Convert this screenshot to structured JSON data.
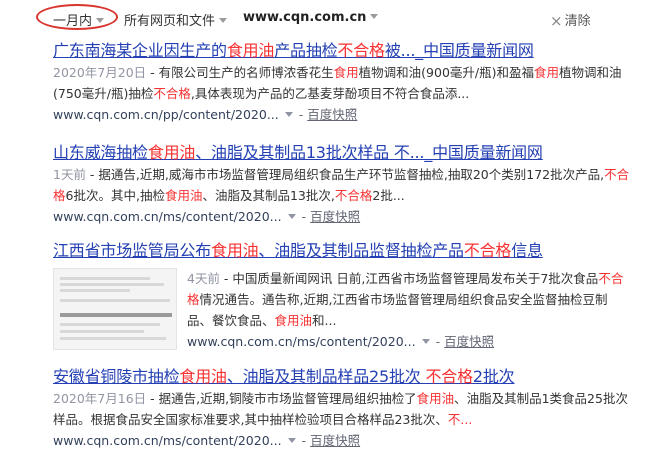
{
  "filters": {
    "time": "一月内",
    "type": "所有网页和文件",
    "site": "www.cqn.com.cn",
    "clear_icon": "close-icon",
    "clear": "清除"
  },
  "colors": {
    "link": "#2440b3",
    "highlight": "#f73131",
    "circle": "#d9352e",
    "date": "#9195a3"
  },
  "results": [
    {
      "title": [
        {
          "t": "广东南海某企业因生产的"
        },
        {
          "t": "食用油",
          "h": true
        },
        {
          "t": "产品抽检"
        },
        {
          "t": "不合格",
          "h": true
        },
        {
          "t": "被..._中国质量新闻网"
        }
      ],
      "snippet": [
        {
          "t": "2020年7月20日",
          "date": true
        },
        {
          "t": " - 有限公司生产的名师博浓香花生"
        },
        {
          "t": "食用",
          "h": true
        },
        {
          "t": "植物调和油(900毫升/瓶)和盈福"
        },
        {
          "t": "食用",
          "h": true
        },
        {
          "t": "植物调和油(750毫升/瓶)抽检"
        },
        {
          "t": "不合格",
          "h": true
        },
        {
          "t": ",具体表现为产品的乙基麦芽酚项目不符合食品添..."
        }
      ],
      "url": "www.cqn.com.cn/pp/content/2020...",
      "snapshot": "百度快照"
    },
    {
      "title": [
        {
          "t": "山东威海抽检"
        },
        {
          "t": "食用油",
          "h": true
        },
        {
          "t": "、油脂及其制品13批次样品 不..._中国质量新闻网"
        }
      ],
      "snippet": [
        {
          "t": "1天前",
          "date": true
        },
        {
          "t": " - 据通告,近期,威海市市场监督管理局组织食品生产环节监督抽检,抽取20个类别172批次产品,"
        },
        {
          "t": "不合格",
          "h": true
        },
        {
          "t": "6批次。其中,抽检"
        },
        {
          "t": "食用油",
          "h": true
        },
        {
          "t": "、油脂及其制品13批次,"
        },
        {
          "t": "不合格",
          "h": true
        },
        {
          "t": "2批..."
        }
      ],
      "url": "www.cqn.com.cn/ms/content/2020...",
      "snapshot": "百度快照"
    },
    {
      "title": [
        {
          "t": "江西省市场监管局公布"
        },
        {
          "t": "食用油",
          "h": true
        },
        {
          "t": "、油脂及其制品监督抽检产品"
        },
        {
          "t": "不合格",
          "h": true
        },
        {
          "t": "信息"
        }
      ],
      "snippet": [
        {
          "t": "4天前",
          "date": true
        },
        {
          "t": " - 中国质量新闻网讯 日前,江西省市场监督管理局发布关于7批次食品"
        },
        {
          "t": "不合格",
          "h": true
        },
        {
          "t": "情况通告。通告称,近期,江西省市场监督管理局组织食品安全监督抽检豆制品、餐饮食品、"
        },
        {
          "t": "食用油",
          "h": true
        },
        {
          "t": "和..."
        }
      ],
      "url": "www.cqn.com.cn/ms/content/2020...",
      "snapshot": "百度快照"
    },
    {
      "title": [
        {
          "t": "安徽省铜陵市抽检"
        },
        {
          "t": "食用油",
          "h": true
        },
        {
          "t": "、油脂及其制品样品25批次 "
        },
        {
          "t": "不合格",
          "h": true
        },
        {
          "t": "2批次"
        }
      ],
      "snippet": [
        {
          "t": "2020年7月16日",
          "date": true
        },
        {
          "t": " - 据通告,近期,铜陵市市场监督管理局组织抽检了"
        },
        {
          "t": "食用油",
          "h": true
        },
        {
          "t": "、油脂及其制品1类食品25批次样品。根据食品安全国家标准要求,其中抽样检验项目合格样品23批次、"
        },
        {
          "t": "不...",
          "h": true
        }
      ],
      "url": "www.cqn.com.cn/ms/content/2020...",
      "snapshot": "百度快照"
    }
  ]
}
